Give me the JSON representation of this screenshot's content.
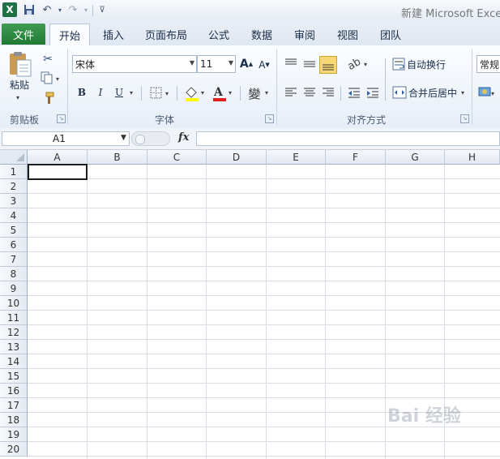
{
  "window": {
    "title": "新建 Microsoft Excel"
  },
  "quick_access": {
    "logo": "X",
    "icons": [
      "save-icon",
      "undo-icon",
      "redo-icon",
      "customize-icon"
    ]
  },
  "tabs": [
    {
      "label": "文件"
    },
    {
      "label": "开始"
    },
    {
      "label": "插入"
    },
    {
      "label": "页面布局"
    },
    {
      "label": "公式"
    },
    {
      "label": "数据"
    },
    {
      "label": "审阅"
    },
    {
      "label": "视图"
    },
    {
      "label": "团队"
    }
  ],
  "ribbon": {
    "clipboard": {
      "paste_label": "粘贴",
      "group_label": "剪贴板"
    },
    "font": {
      "name": "宋体",
      "size": "11",
      "group_label": "字体",
      "bold": "B",
      "italic": "I",
      "underline": "U",
      "grow": "A",
      "shrink": "A"
    },
    "alignment": {
      "wrap_label": "自动换行",
      "merge_label": "合并后居中",
      "group_label": "对齐方式"
    },
    "number": {
      "format": "常规"
    }
  },
  "formula_bar": {
    "name_box": "A1",
    "fx": "fx",
    "value": ""
  },
  "sheet": {
    "columns": [
      "A",
      "B",
      "C",
      "D",
      "E",
      "F",
      "G",
      "H"
    ],
    "rows": [
      "1",
      "2",
      "3",
      "4",
      "5",
      "6",
      "7",
      "8",
      "9",
      "10",
      "11",
      "12",
      "13",
      "14",
      "15",
      "16",
      "17",
      "18",
      "19",
      "20"
    ]
  },
  "watermark": {
    "text": "Bai 经验"
  },
  "colors": {
    "file_tab": "#2e8b45",
    "excel_green": "#1e7145",
    "highlight": "#f8d872"
  }
}
